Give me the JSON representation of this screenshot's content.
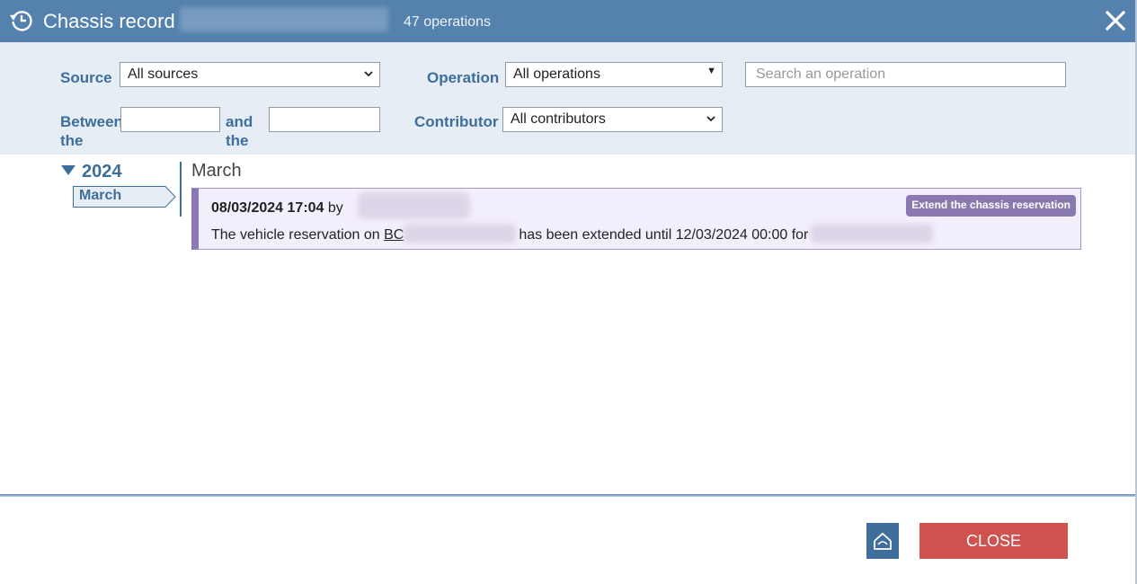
{
  "header": {
    "title": "Chassis record",
    "operations_count": "47 operations",
    "icon": "history-icon",
    "close_icon": "close-icon"
  },
  "filters": {
    "source_label": "Source",
    "source_value": "All sources",
    "operation_label": "Operation",
    "operation_value": "All operations",
    "search_placeholder": "Search an operation",
    "between_label_1": "Between",
    "between_label_2": "the",
    "and_label_1": "and",
    "and_label_2": "the",
    "contributor_label": "Contributor",
    "contributor_value": "All contributors"
  },
  "timeline": {
    "year": "2024",
    "months": [
      {
        "label": "March",
        "selected": true
      }
    ],
    "current_month_heading": "March"
  },
  "entries": [
    {
      "datetime": "08/03/2024 17:04",
      "by": "by",
      "tag": "Extend the chassis reservation",
      "text_prefix": "The vehicle reservation on ",
      "vehicle_prefix": "BC",
      "text_middle": "has been extended until 12/03/2024 00:00 for"
    }
  ],
  "footer": {
    "export_icon": "export-icon",
    "close_label": "CLOSE"
  },
  "colors": {
    "header_bg": "#5481ad",
    "filter_bg": "#e6edf5",
    "label_blue": "#3e6e9c",
    "entry_bg": "#f3eefb",
    "entry_accent": "#8d78b7",
    "close_btn": "#d0524f"
  }
}
